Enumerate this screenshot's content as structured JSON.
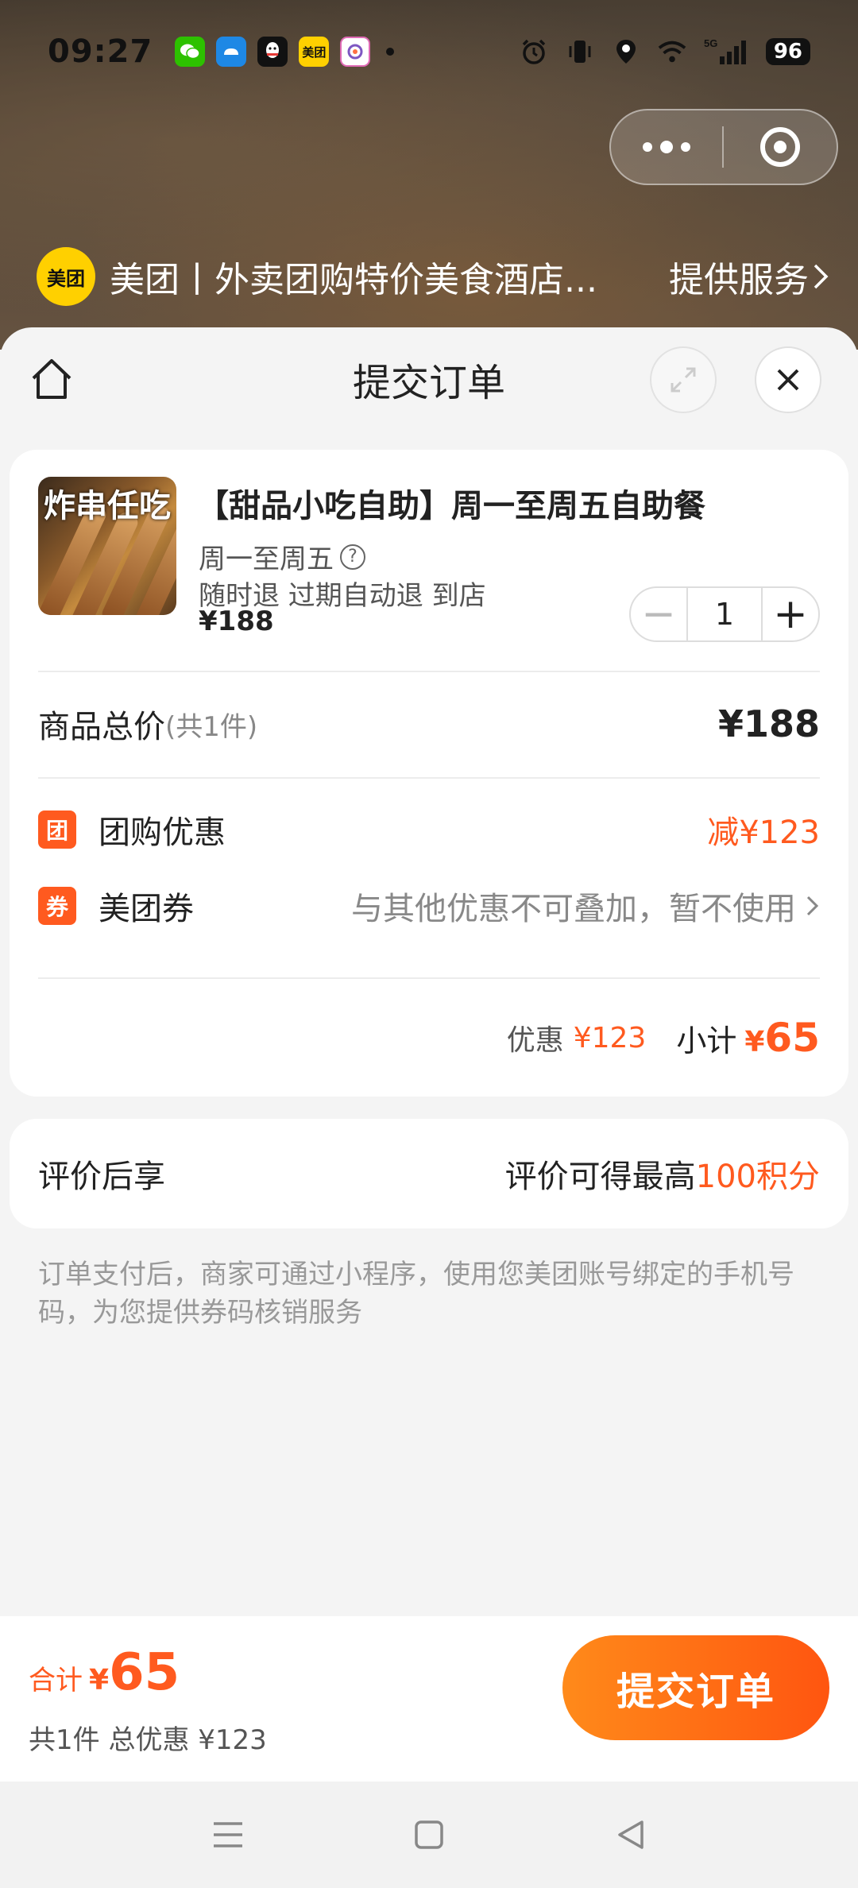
{
  "status_bar": {
    "time": "09:27",
    "notifications": [
      {
        "icon": "wechat-icon",
        "color": "#2dc100",
        "label": ""
      },
      {
        "icon": "baidu-netdisk-icon",
        "color": "#1e88e5",
        "label": ""
      },
      {
        "icon": "qq-icon",
        "color": "#111111",
        "label": ""
      },
      {
        "icon": "meituan-icon",
        "color": "#ffd000",
        "label": "美团"
      },
      {
        "icon": "app-icon",
        "color": "#e06ab5",
        "label": ""
      }
    ],
    "network": "5G",
    "battery": "96"
  },
  "capsule": {
    "more_icon": "more-dots-icon",
    "close_icon": "target-circle-icon"
  },
  "service_bar": {
    "logo_text": "美团",
    "title": "美团丨外卖团购特价美食酒店...",
    "link": "提供服务"
  },
  "sheet": {
    "title": "提交订单",
    "home_icon": "home-icon",
    "expand_icon": "expand-icon",
    "close_icon": "close-icon"
  },
  "product": {
    "image_text": "炸串任吃",
    "name": "【甜品小吃自助】周一至周五自助餐",
    "schedule": "周一至周五",
    "help_icon": "?",
    "policy": "随时退 过期自动退 到店",
    "price": "¥188",
    "quantity": "1",
    "minus_label": "−",
    "plus_label": "+"
  },
  "summary": {
    "total_label": "商品总价",
    "total_count": "(共1件)",
    "total_price": "¥188",
    "group_badge": "团",
    "group_label": "团购优惠",
    "group_discount": "减¥123",
    "coupon_badge": "券",
    "coupon_label": "美团券",
    "coupon_note": "与其他优惠不可叠加，暂不使用",
    "discount_label": "优惠",
    "discount_value": "¥123",
    "subtotal_label": "小计",
    "subtotal_yen": "¥",
    "subtotal_value": "65"
  },
  "review": {
    "label": "评价后享",
    "text": "评价可得最高",
    "points": "100积分"
  },
  "notice": "订单支付后，商家可通过小程序，使用您美团账号绑定的手机号码，为您提供券码核销服务",
  "bottom_bar": {
    "total_label": "合计",
    "yen": "¥",
    "amount": "65",
    "sub": "共1件 总优惠 ¥123",
    "submit_label": "提交订单"
  },
  "colors": {
    "accent": "#ff5a1f",
    "brand_yellow": "#ffd000"
  }
}
